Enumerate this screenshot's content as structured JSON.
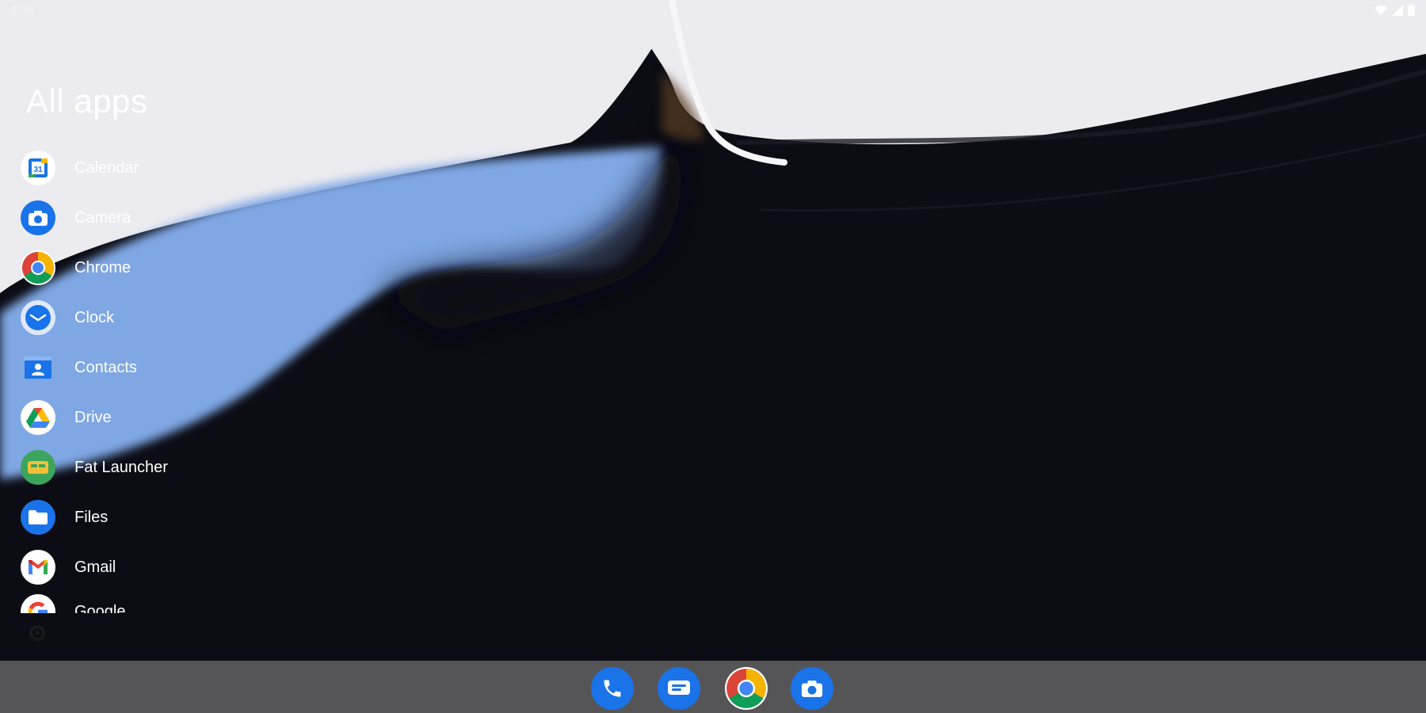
{
  "status_bar": {
    "time": "1:34",
    "icons": [
      "wifi-icon",
      "signal-icon",
      "battery-icon"
    ]
  },
  "app_drawer": {
    "title": "All apps",
    "apps": [
      {
        "label": "Calendar",
        "icon": "calendar-icon"
      },
      {
        "label": "Camera",
        "icon": "camera-icon"
      },
      {
        "label": "Chrome",
        "icon": "chrome-icon"
      },
      {
        "label": "Clock",
        "icon": "clock-icon"
      },
      {
        "label": "Contacts",
        "icon": "contacts-icon"
      },
      {
        "label": "Drive",
        "icon": "drive-icon"
      },
      {
        "label": "Fat Launcher",
        "icon": "fat-launcher-icon"
      },
      {
        "label": "Files",
        "icon": "files-icon"
      },
      {
        "label": "Gmail",
        "icon": "gmail-icon"
      },
      {
        "label": "Google",
        "icon": "google-icon"
      }
    ]
  },
  "dock": {
    "apps": [
      "phone-icon",
      "messages-icon",
      "chrome-icon",
      "camera-icon"
    ]
  },
  "colors": {
    "dock_background": "#555558",
    "icon_blue": "#1a73e8",
    "wallpaper_dark": "#0b0c14",
    "wallpaper_light": "#ecebf0",
    "wallpaper_blue": "#7fa7e4"
  }
}
